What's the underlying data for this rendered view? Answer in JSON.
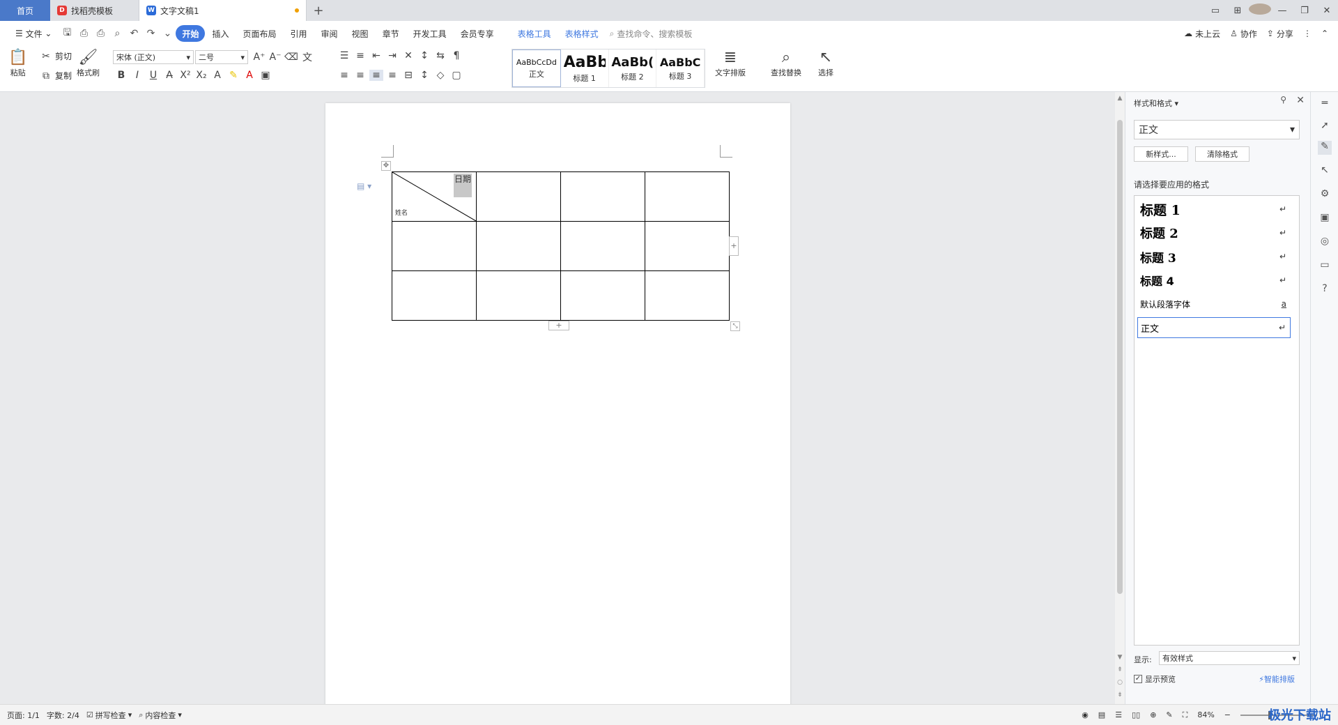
{
  "tabs": {
    "home": "首页",
    "template": "找稻壳模板",
    "doc": "文字文稿1",
    "add": "+"
  },
  "menu": {
    "file": "文件",
    "items": [
      "开始",
      "插入",
      "页面布局",
      "引用",
      "审阅",
      "视图",
      "章节",
      "开发工具",
      "会员专享"
    ],
    "context": [
      "表格工具",
      "表格样式"
    ],
    "search_placeholder": "查找命令、搜索模板",
    "cloud": "未上云",
    "collab": "协作",
    "share": "分享"
  },
  "ribbon": {
    "paste": "粘贴",
    "cut": "剪切",
    "copy": "复制",
    "format_painter": "格式刷",
    "font_name": "宋体 (正文)",
    "font_size": "二号",
    "styles": [
      {
        "preview": "AaBbCcDd",
        "name": "正文"
      },
      {
        "preview": "AaBb",
        "name": "标题 1"
      },
      {
        "preview": "AaBb(",
        "name": "标题 2"
      },
      {
        "preview": "AaBbC",
        "name": "标题 3"
      }
    ],
    "text_layout": "文字排版",
    "find_replace": "查找替换",
    "select": "选择"
  },
  "document": {
    "cell_date": "日期",
    "cell_name": "姓名"
  },
  "pane": {
    "title": "样式和格式",
    "current": "正文",
    "new_style": "新样式...",
    "clear_format": "清除格式",
    "choose_label": "请选择要应用的格式",
    "styles": [
      {
        "label": "标题  1",
        "mark": "↵"
      },
      {
        "label": "标题  2",
        "mark": "↵"
      },
      {
        "label": "标题  3",
        "mark": "↵"
      },
      {
        "label": "标题  4",
        "mark": "↵"
      },
      {
        "label": "默认段落字体",
        "mark": "a"
      },
      {
        "label": "正文",
        "mark": "↵"
      }
    ],
    "show_label": "显示:",
    "show_value": "有效样式",
    "preview": "显示预览",
    "smart": "智能排版"
  },
  "status": {
    "page": "页面: 1/1",
    "words": "字数: 2/4",
    "spell": "拼写检查",
    "content": "内容检查",
    "zoom": "84%"
  },
  "watermark": "极光下载站"
}
